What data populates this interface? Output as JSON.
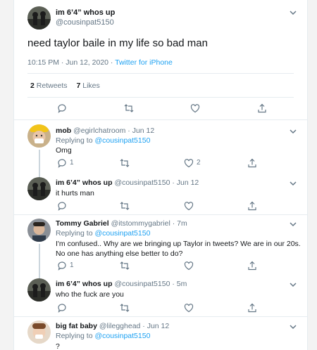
{
  "main_tweet": {
    "name": "im 6’4” whos up",
    "handle": "@cousinpat5150",
    "text": "need taylor baile in my life so bad man",
    "time": "10:15 PM · Jun 12, 2020 · ",
    "source": "Twitter for iPhone",
    "retweets_count": "2",
    "retweets_label": "Retweets",
    "likes_count": "7",
    "likes_label": "Likes"
  },
  "replies": [
    {
      "name": "mob",
      "handle_date": "@egirlchatroom · Jun 12",
      "replying_prefix": "Replying to ",
      "replying_to": "@cousinpat5150",
      "text": "Omg",
      "reply_count": "1",
      "like_count": "2"
    },
    {
      "name": "im 6’4” whos up",
      "handle_date": "@cousinpat5150 · Jun 12",
      "text": "it hurts man"
    },
    {
      "name": "Tommy Gabriel",
      "handle_date": "@itstommygabriel · 7m",
      "replying_prefix": "Replying to ",
      "replying_to": "@cousinpat5150",
      "text_line1": "I'm confused.. Why are we bringing up Taylor in tweets? We are in our 20s.",
      "text_line2": "No one has anything else better to do?",
      "reply_count": "1"
    },
    {
      "name": "im 6’4” whos up",
      "handle_date": "@cousinpat5150 · 5m",
      "text": "who the fuck are you"
    },
    {
      "name": "big fat baby",
      "handle_date": "@lilegghead · Jun 12",
      "replying_prefix": "Replying to ",
      "replying_to": "@cousinpat5150",
      "text": "?"
    }
  ],
  "colors": {
    "accent": "#1da1f2",
    "secondary": "#657786",
    "thread": "#ccd6dd",
    "divider": "#e6ecf0"
  },
  "icons": [
    "chevron-down-icon",
    "reply-icon",
    "retweet-icon",
    "like-icon",
    "share-icon"
  ]
}
